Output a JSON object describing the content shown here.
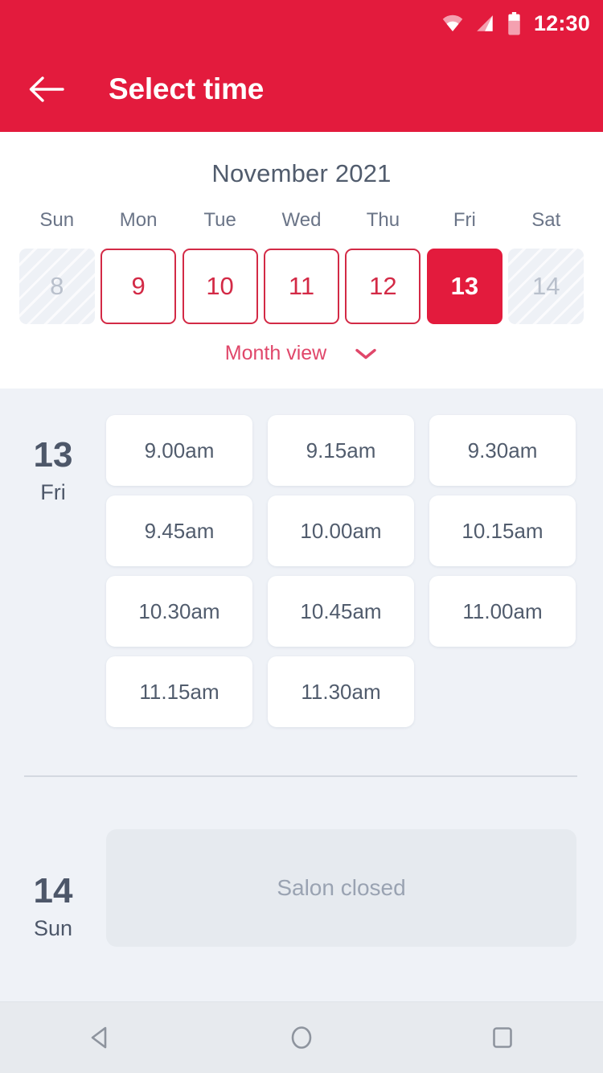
{
  "status_bar": {
    "time": "12:30",
    "icons": [
      "wifi-icon",
      "signal-icon",
      "battery-icon"
    ]
  },
  "app_bar": {
    "back_icon": "back-arrow-icon",
    "title": "Select time"
  },
  "calendar": {
    "month_label": "November 2021",
    "weekday_headers": [
      "Sun",
      "Mon",
      "Tue",
      "Wed",
      "Thu",
      "Fri",
      "Sat"
    ],
    "days": [
      {
        "number": "8",
        "state": "disabled"
      },
      {
        "number": "9",
        "state": "available"
      },
      {
        "number": "10",
        "state": "available"
      },
      {
        "number": "11",
        "state": "available"
      },
      {
        "number": "12",
        "state": "available"
      },
      {
        "number": "13",
        "state": "selected"
      },
      {
        "number": "14",
        "state": "disabled"
      }
    ],
    "view_toggle_label": "Month view",
    "view_toggle_icon": "chevron-down-icon"
  },
  "schedule": {
    "days": [
      {
        "day_number": "13",
        "day_name": "Fri",
        "slots": [
          "9.00am",
          "9.15am",
          "9.30am",
          "9.45am",
          "10.00am",
          "10.15am",
          "10.30am",
          "10.45am",
          "11.00am",
          "11.15am",
          "11.30am"
        ]
      },
      {
        "day_number": "14",
        "day_name": "Sun",
        "closed_label": "Salon closed"
      }
    ]
  },
  "nav_bar": {
    "buttons": [
      "back-triangle-icon",
      "home-circle-icon",
      "recents-square-icon"
    ]
  },
  "colors": {
    "brand_red": "#e31b3d",
    "day_border_red": "#d32a46",
    "toggle_red": "#e0476a",
    "text_slate": "#515c6d",
    "heading_slate": "#4d5769",
    "muted_gray": "#9aa3b2",
    "disabled_gray": "#b9c0cc",
    "page_bg": "#eff2f7",
    "closed_card_bg": "#e6eaef",
    "nav_bg": "#e7eaee"
  }
}
